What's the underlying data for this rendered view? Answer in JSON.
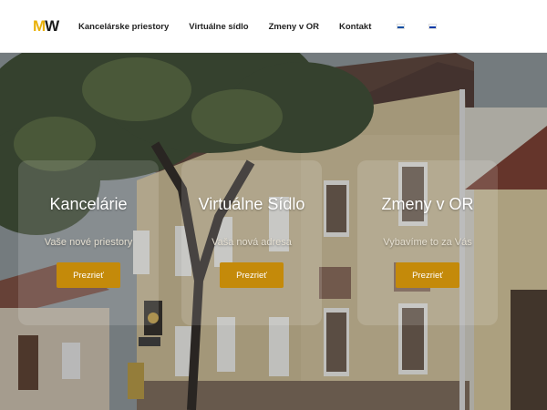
{
  "logo": {
    "part1": "M",
    "part2": "W"
  },
  "nav": {
    "items": [
      {
        "label": "Kancelárske priestory"
      },
      {
        "label": "Virtuálne sídlo"
      },
      {
        "label": "Zmeny v OR"
      },
      {
        "label": "Kontakt"
      }
    ],
    "flags": [
      {
        "icon": "slovak-flag-icon",
        "colors": [
          "#ffffff",
          "#0b4ea2",
          "#ee1c25"
        ]
      },
      {
        "icon": "russian-flag-icon",
        "colors": [
          "#ffffff",
          "#0039a6",
          "#d52b1e"
        ]
      }
    ]
  },
  "hero": {
    "cards": [
      {
        "title": "Kancelárie",
        "subtitle": "Vaše nové priestory",
        "button": "Prezrieť"
      },
      {
        "title": "Virtuálne Sídlo",
        "subtitle": "Vaša nová adresa",
        "button": "Prezrieť"
      },
      {
        "title": "Zmeny v OR",
        "subtitle": "Vybavíme to za Vás",
        "button": "Prezrieť"
      }
    ]
  },
  "colors": {
    "accent": "#c48a0a",
    "logo_yellow": "#e9b10a"
  }
}
